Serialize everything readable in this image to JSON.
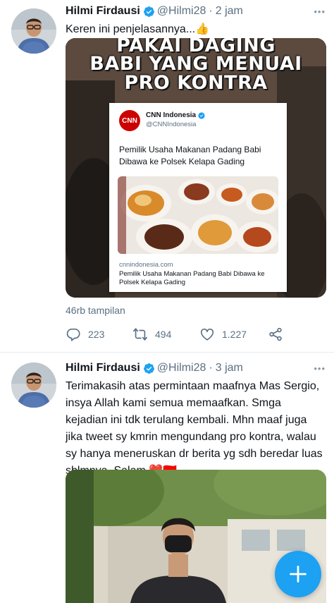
{
  "tweets": [
    {
      "name": "Hilmi Firdausi",
      "handle": "@Hilmi28",
      "separator": "·",
      "time": "2 jam",
      "text": "Keren ini penjelasannya...👍",
      "media": {
        "overlay_lines": [
          "PAKAI DAGING",
          "BABI YANG MENUAI",
          "PRO KONTRA"
        ],
        "embedded_tweet": {
          "account_name": "CNN Indonesia",
          "account_handle": "@CNNIndonesia",
          "logo_text": "CNN",
          "text": "Pemilik Usaha Makanan Padang Babi Dibawa ke Polsek Kelapa Gading",
          "link_domain": "cnnindonesia.com",
          "link_title": "Pemilik Usaha Makanan Padang Babi Dibawa ke Polsek Kelapa Gading"
        }
      },
      "views": "46rb tampilan",
      "stats": {
        "replies": "223",
        "retweets": "494",
        "likes": "1.227"
      }
    },
    {
      "name": "Hilmi Firdausi",
      "handle": "@Hilmi28",
      "separator": "·",
      "time": "3 jam",
      "text": "Terimakasih atas permintaan maafnya Mas Sergio, insya Allah kami semua memaafkan. Smga kejadian ini tdk terulang kembali. Mhn maaf juga jika tweet sy kmrin mengundang pro kontra, walau sy hanya meneruskan dr berita yg sdh beredar luas sblmnya. Salam ❤️🇮🇩"
    }
  ],
  "icons": {
    "verified": "verified-badge-icon",
    "reply": "reply-icon",
    "retweet": "retweet-icon",
    "like": "heart-icon",
    "share": "share-icon",
    "compose": "plus-icon"
  },
  "colors": {
    "accent": "#1da1f2",
    "text": "#0f1419",
    "secondary": "#5b7083",
    "cnn_red": "#cc0000"
  }
}
